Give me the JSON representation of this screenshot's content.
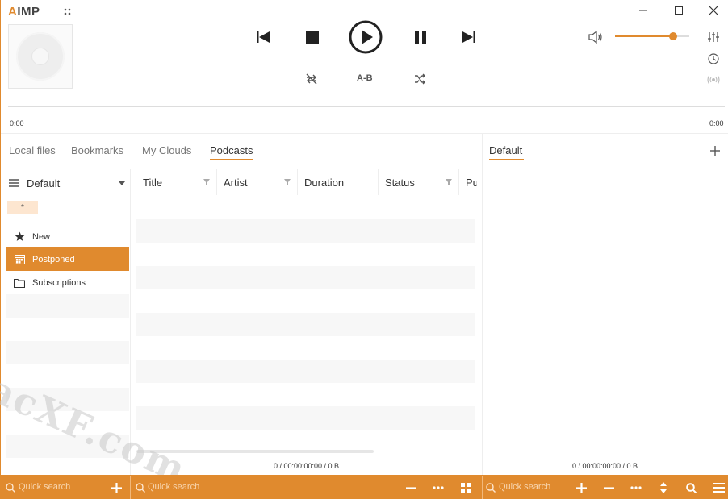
{
  "app": {
    "logo_text": "IMP",
    "logo_accent": "A"
  },
  "window_controls": {
    "minimize": "minimize-icon",
    "maximize": "maximize-icon",
    "close": "close-icon"
  },
  "transport": {
    "ab_label": "A-B"
  },
  "volume": {
    "level": 0.78
  },
  "seek": {
    "elapsed": "0:00",
    "remaining": "0:00"
  },
  "left_tabs": [
    {
      "label": "Local files",
      "active": false
    },
    {
      "label": "Bookmarks",
      "active": false
    },
    {
      "label": "My Clouds",
      "active": false
    },
    {
      "label": "Podcasts",
      "active": true
    }
  ],
  "playlist_tab": {
    "label": "Default"
  },
  "podcasts": {
    "group_label": "Default",
    "filter_chip": "*",
    "items": [
      {
        "label": "New",
        "icon": "star-icon",
        "selected": false
      },
      {
        "label": "Postponed",
        "icon": "calendar-icon",
        "selected": true
      },
      {
        "label": "Subscriptions",
        "icon": "folder-icon",
        "selected": false
      }
    ]
  },
  "table": {
    "columns": [
      "Title",
      "Artist",
      "Duration",
      "Status",
      "Pu"
    ],
    "summary": "0 / 00:00:00:00 / 0 B"
  },
  "playlist": {
    "summary": "0 / 00:00:00:00 / 0 B"
  },
  "bottom": {
    "search_placeholder_left": "Quick search",
    "search_placeholder_middle": "Quick search",
    "search_placeholder_right": "Quick search"
  },
  "watermark": "acXF.com",
  "colors": {
    "accent": "#e08a2e"
  }
}
